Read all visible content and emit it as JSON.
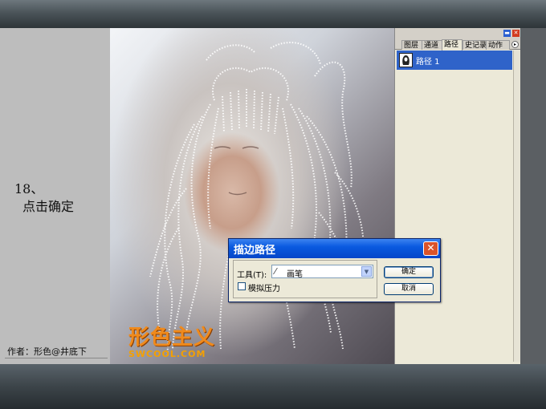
{
  "tutorial": {
    "step_number": "18、",
    "step_action": "点击确定",
    "author": "作者：形色@井底下"
  },
  "watermark": {
    "title": "形色主义",
    "subtitle": "SWCOOL.COM"
  },
  "panel": {
    "tabs": [
      "图层",
      "通道",
      "路径",
      "史记录",
      "动作"
    ],
    "active_tab": "路径",
    "path_item_label": "路径 1"
  },
  "dialog": {
    "title": "描边路径",
    "tool_label": "工具(T):",
    "tool_value": "画笔",
    "simulate_pressure_label": "模拟压力",
    "simulate_pressure_checked": false,
    "ok_label": "确定",
    "cancel_label": "取消"
  },
  "colors": {
    "dialog_title_blue": "#0a5ae0",
    "path_selection_blue": "#2f63c9",
    "watermark_orange": "#f08a1c"
  }
}
